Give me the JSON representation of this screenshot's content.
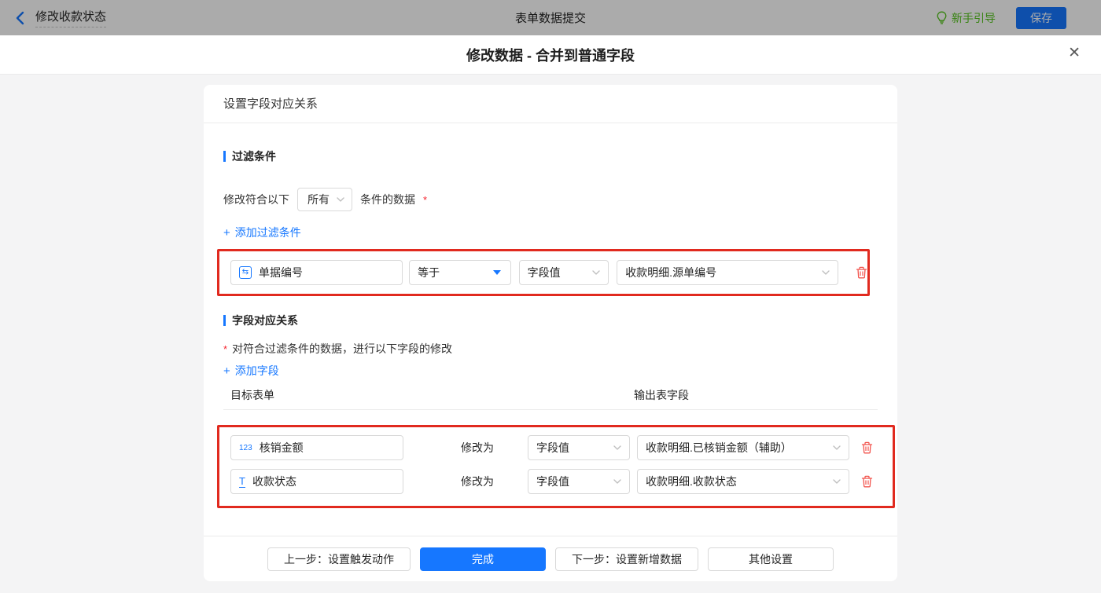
{
  "toolbar": {
    "back_title": "修改收款状态",
    "center_title": "表单数据提交",
    "guide_label": "新手引导",
    "save_label": "保存"
  },
  "dialog": {
    "title": "修改数据 - 合并到普通字段",
    "close_icon": "✕"
  },
  "card": {
    "header": "设置字段对应关系",
    "filter_section": {
      "title": "过滤条件",
      "match_prefix": "修改符合以下",
      "match_select_value": "所有",
      "match_suffix": "条件的数据",
      "required_mark": "*",
      "plus": "+",
      "add_label": "添加过滤条件",
      "row": {
        "field": "单据编号",
        "field_icon_glyph": "⇆",
        "operator": "等于",
        "value_type": "字段值",
        "value": "收款明细.源单编号"
      }
    },
    "mapping_section": {
      "title": "字段对应关系",
      "required_mark": "*",
      "description": "对符合过滤条件的数据，进行以下字段的修改",
      "plus": "+",
      "add_label": "添加字段",
      "col_target": "目标表单",
      "col_output": "输出表字段",
      "modify_label": "修改为",
      "rows": [
        {
          "icon_text": "123",
          "field": "核销金额",
          "value_type": "字段值",
          "value": "收款明细.已核销金额（辅助）"
        },
        {
          "icon_text": "T",
          "field": "收款状态",
          "value_type": "字段值",
          "value": "收款明细.收款状态"
        }
      ]
    },
    "footer": {
      "prev_label": "上一步：设置触发动作",
      "done_label": "完成",
      "next_label": "下一步：设置新增数据",
      "other_label": "其他设置"
    }
  },
  "colors": {
    "accent_blue": "#1677ff",
    "guide_green": "#52c41a",
    "annotation_red": "#e12a1f",
    "trash_red": "#f2544d",
    "page_bg": "#f4f4f5"
  }
}
